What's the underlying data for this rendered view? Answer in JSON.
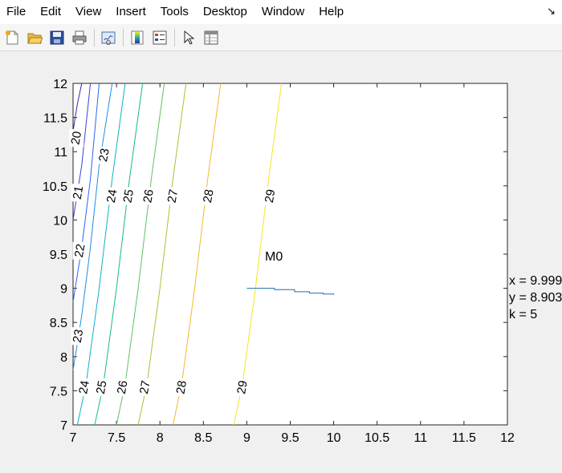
{
  "menu": [
    "File",
    "Edit",
    "View",
    "Insert",
    "Tools",
    "Desktop",
    "Window",
    "Help"
  ],
  "dock_icon": "undock-arrow-icon",
  "toolbar": [
    {
      "name": "new-figure-icon"
    },
    {
      "name": "open-file-icon"
    },
    {
      "name": "save-figure-icon"
    },
    {
      "name": "print-figure-icon"
    },
    {
      "sep": true
    },
    {
      "name": "link-plot-icon"
    },
    {
      "sep": true
    },
    {
      "name": "insert-colorbar-icon"
    },
    {
      "name": "insert-legend-icon"
    },
    {
      "sep": true
    },
    {
      "name": "edit-plot-arrow-icon"
    },
    {
      "name": "property-inspector-icon"
    }
  ],
  "annotations": {
    "m0_label": "M0",
    "x_readout": "x = 9.999",
    "y_readout": "y = 8.903",
    "k_readout": "k = 5"
  },
  "chart_data": {
    "type": "contour",
    "xlim": [
      7,
      12
    ],
    "ylim": [
      7,
      12
    ],
    "x_ticks": [
      "7",
      "7.5",
      "8",
      "8.5",
      "9",
      "9.5",
      "10",
      "10.5",
      "11",
      "11.5",
      "12"
    ],
    "y_ticks": [
      "7",
      "7.5",
      "8",
      "8.5",
      "9",
      "9.5",
      "10",
      "10.5",
      "11",
      "11.5",
      "12"
    ],
    "grid": false,
    "levels": [
      {
        "value": "20",
        "color": "#3f26a6",
        "path": [
          [
            7.0,
            11.3
          ],
          [
            7.05,
            11.7
          ],
          [
            7.1,
            12.0
          ]
        ],
        "labels": [
          {
            "text": "20",
            "x": 7.04,
            "y": 11.2
          }
        ]
      },
      {
        "value": "21",
        "color": "#3b3fd6",
        "path": [
          [
            7.0,
            10.0
          ],
          [
            7.1,
            10.8
          ],
          [
            7.2,
            12.0
          ]
        ],
        "labels": [
          {
            "text": "21",
            "x": 7.06,
            "y": 10.4
          }
        ]
      },
      {
        "value": "22",
        "color": "#2f64f2",
        "path": [
          [
            7.0,
            8.8
          ],
          [
            7.1,
            9.6
          ],
          [
            7.2,
            10.6
          ],
          [
            7.3,
            12.0
          ]
        ],
        "labels": [
          {
            "text": "22",
            "x": 7.08,
            "y": 9.55
          }
        ]
      },
      {
        "value": "23",
        "color": "#1d8ee6",
        "path": [
          [
            7.0,
            7.8
          ],
          [
            7.1,
            8.6
          ],
          [
            7.2,
            9.6
          ],
          [
            7.3,
            10.8
          ],
          [
            7.45,
            12.0
          ]
        ],
        "labels": [
          {
            "text": "23",
            "x": 7.06,
            "y": 8.3
          },
          {
            "text": "23",
            "x": 7.36,
            "y": 10.95
          }
        ]
      },
      {
        "value": "24",
        "color": "#0bb1c6",
        "path": [
          [
            7.05,
            7.0
          ],
          [
            7.15,
            7.6
          ],
          [
            7.3,
            9.0
          ],
          [
            7.45,
            10.6
          ],
          [
            7.6,
            12.0
          ]
        ],
        "labels": [
          {
            "text": "24",
            "x": 7.13,
            "y": 7.55
          },
          {
            "text": "24",
            "x": 7.45,
            "y": 10.35
          }
        ]
      },
      {
        "value": "25",
        "color": "#13b796",
        "path": [
          [
            7.25,
            7.0
          ],
          [
            7.35,
            7.6
          ],
          [
            7.5,
            9.0
          ],
          [
            7.65,
            10.6
          ],
          [
            7.8,
            12.0
          ]
        ],
        "labels": [
          {
            "text": "25",
            "x": 7.33,
            "y": 7.55
          },
          {
            "text": "25",
            "x": 7.64,
            "y": 10.35
          }
        ]
      },
      {
        "value": "26",
        "color": "#5fc15c",
        "path": [
          [
            7.5,
            7.0
          ],
          [
            7.6,
            7.6
          ],
          [
            7.75,
            9.0
          ],
          [
            7.9,
            10.6
          ],
          [
            8.05,
            12.0
          ]
        ],
        "labels": [
          {
            "text": "26",
            "x": 7.57,
            "y": 7.55
          },
          {
            "text": "26",
            "x": 7.87,
            "y": 10.35
          }
        ]
      },
      {
        "value": "27",
        "color": "#b3bd35",
        "path": [
          [
            7.75,
            7.0
          ],
          [
            7.85,
            7.6
          ],
          [
            8.0,
            9.0
          ],
          [
            8.15,
            10.6
          ],
          [
            8.3,
            12.0
          ]
        ],
        "labels": [
          {
            "text": "27",
            "x": 7.83,
            "y": 7.55
          },
          {
            "text": "27",
            "x": 8.15,
            "y": 10.35
          }
        ]
      },
      {
        "value": "28",
        "color": "#f0ba2e",
        "path": [
          [
            8.15,
            7.0
          ],
          [
            8.25,
            7.6
          ],
          [
            8.4,
            9.0
          ],
          [
            8.55,
            10.6
          ],
          [
            8.7,
            12.0
          ]
        ],
        "labels": [
          {
            "text": "28",
            "x": 8.25,
            "y": 7.55
          },
          {
            "text": "28",
            "x": 8.56,
            "y": 10.35
          }
        ]
      },
      {
        "value": "29",
        "color": "#f5e61e",
        "path": [
          [
            8.85,
            7.0
          ],
          [
            8.95,
            7.6
          ],
          [
            9.1,
            9.0
          ],
          [
            9.25,
            10.6
          ],
          [
            9.4,
            12.0
          ]
        ],
        "labels": [
          {
            "text": "29",
            "x": 8.95,
            "y": 7.55
          },
          {
            "text": "29",
            "x": 9.27,
            "y": 10.35
          }
        ]
      }
    ],
    "trajectory": {
      "color": "#1f6fb0",
      "points": [
        [
          9.0,
          9.0
        ],
        [
          9.32,
          9.0
        ],
        [
          9.32,
          8.98
        ],
        [
          9.55,
          8.98
        ],
        [
          9.55,
          8.95
        ],
        [
          9.72,
          8.95
        ],
        [
          9.72,
          8.93
        ],
        [
          9.88,
          8.93
        ],
        [
          9.88,
          8.915
        ],
        [
          10.0,
          8.915
        ],
        [
          10.0,
          8.905
        ]
      ]
    }
  }
}
